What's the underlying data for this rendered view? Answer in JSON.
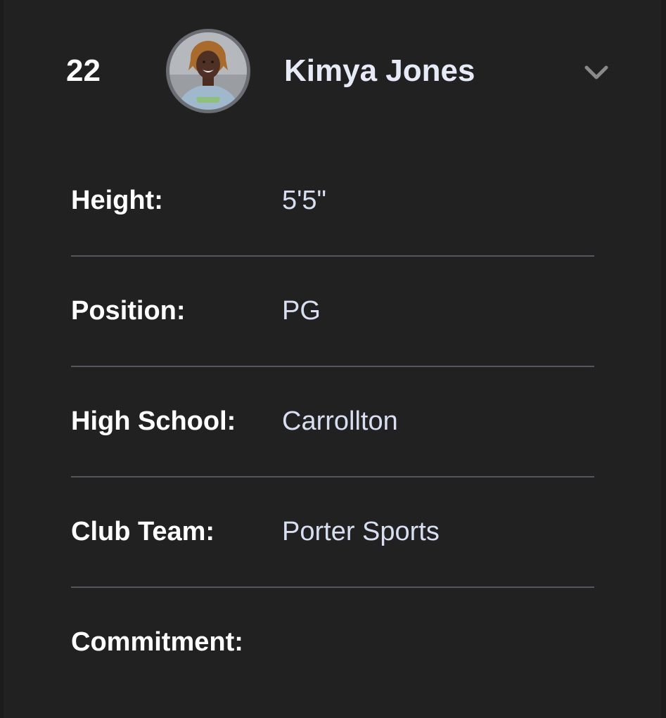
{
  "player": {
    "number": "22",
    "name": "Kimya Jones",
    "avatar_icon": "player-photo",
    "expand_icon": "chevron-down-icon"
  },
  "details": [
    {
      "label": "Height:",
      "value": "5'5\""
    },
    {
      "label": "Position:",
      "value": "PG"
    },
    {
      "label": "High School:",
      "value": "Carrollton"
    },
    {
      "label": "Club Team:",
      "value": "Porter Sports"
    },
    {
      "label": "Commitment:",
      "value": ""
    }
  ],
  "colors": {
    "background": "#212121",
    "divider": "#55575e",
    "label_text": "#ffffff",
    "value_text": "#d8dff0",
    "chevron": "#8a8a8a"
  }
}
